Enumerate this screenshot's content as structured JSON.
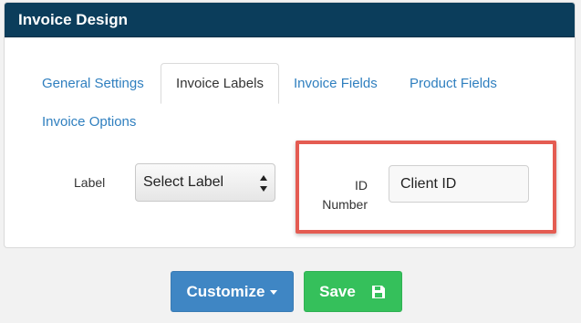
{
  "panel": {
    "title": "Invoice Design"
  },
  "tabs": [
    {
      "label": "General Settings"
    },
    {
      "label": "Invoice Labels"
    },
    {
      "label": "Invoice Fields"
    },
    {
      "label": "Product Fields"
    },
    {
      "label": "Invoice Options"
    }
  ],
  "form": {
    "label_caption": "Label",
    "select_label": "Select Label",
    "id_number_label": "ID Number",
    "client_id_value": "Client ID"
  },
  "actions": {
    "customize_label": "Customize",
    "save_label": "Save"
  },
  "icons": {
    "select_arrows": "updown-arrows-icon",
    "customize_caret": "caret-down-icon",
    "save": "floppy-disk-icon"
  },
  "colors": {
    "header_bg": "#0b3d5b",
    "tab_link": "#2f7fbf",
    "highlight": "#e45c52",
    "customize_btn": "#3f86c4",
    "save_btn": "#35c05b"
  }
}
